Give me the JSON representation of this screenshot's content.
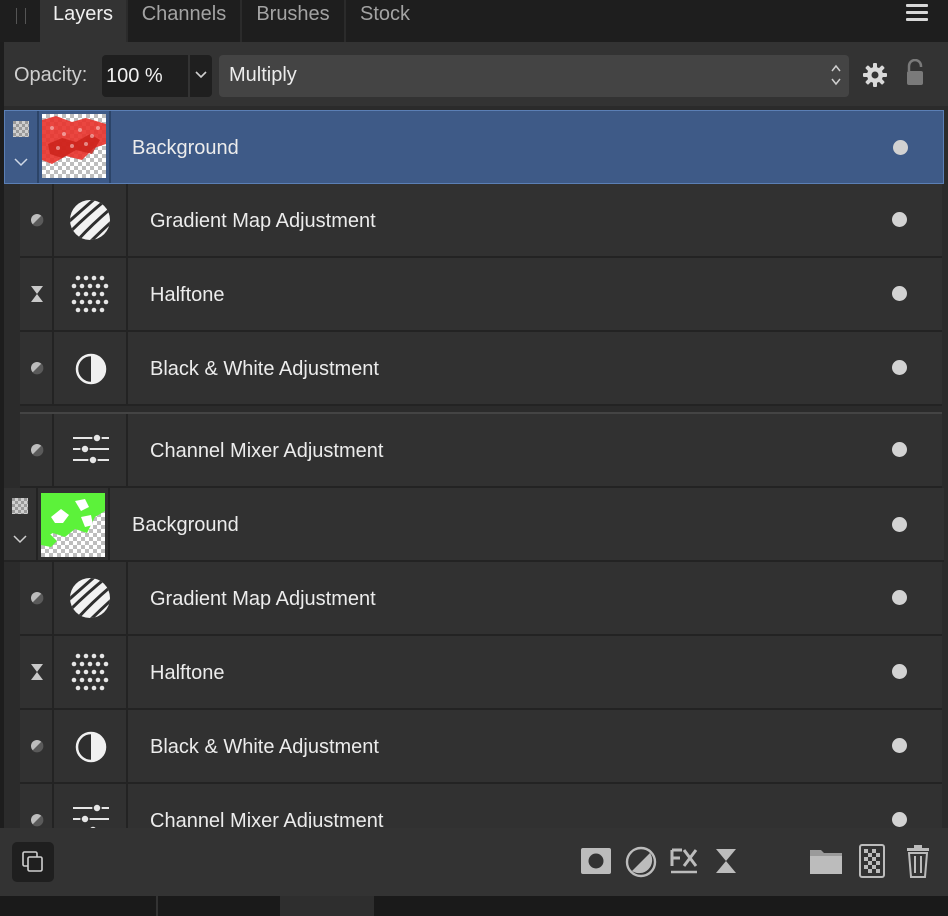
{
  "tabs": [
    {
      "label": "Layers",
      "active": true
    },
    {
      "label": "Channels",
      "active": false
    },
    {
      "label": "Brushes",
      "active": false
    },
    {
      "label": "Stock",
      "active": false
    }
  ],
  "toolbar": {
    "opacity_label": "Opacity:",
    "opacity_value": "100 %",
    "blend_mode": "Multiply"
  },
  "icons": {
    "menu": "hamburger-menu-icon",
    "gear": "gear-icon",
    "lock": "lock-icon",
    "gradient_map": "gradient-map-icon",
    "halftone": "halftone-icon",
    "bw": "black-white-icon",
    "mixer": "channel-mixer-icon"
  },
  "colors": {
    "selected_row": "#3e5a87",
    "red_thumb": "#e8322b",
    "green_thumb": "#5cf23a"
  },
  "groups": [
    {
      "name": "Background",
      "selected": true,
      "thumb_color": "red",
      "children": [
        {
          "label": "Gradient Map Adjustment",
          "type": "gradient"
        },
        {
          "label": "Halftone",
          "type": "halftone"
        },
        {
          "label": "Black & White Adjustment",
          "type": "bw"
        },
        {
          "label": "Channel Mixer Adjustment",
          "type": "mixer"
        }
      ]
    },
    {
      "name": "Background",
      "selected": false,
      "thumb_color": "green",
      "children": [
        {
          "label": "Gradient Map Adjustment",
          "type": "gradient"
        },
        {
          "label": "Halftone",
          "type": "halftone"
        },
        {
          "label": "Black & White Adjustment",
          "type": "bw"
        },
        {
          "label": "Channel Mixer Adjustment",
          "type": "mixer"
        }
      ]
    }
  ]
}
